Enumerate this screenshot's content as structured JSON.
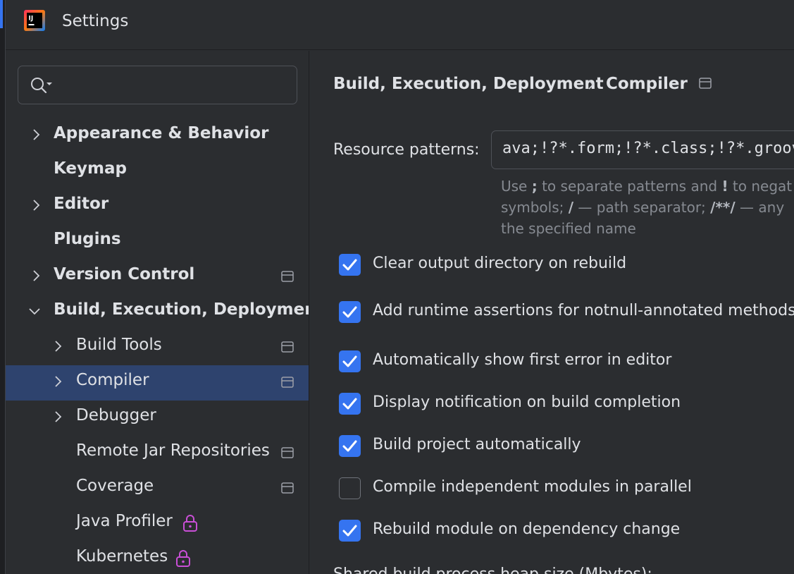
{
  "window": {
    "title": "Settings",
    "app_icon": "intellij-idea-icon"
  },
  "sidebar": {
    "search_placeholder": "",
    "items": [
      {
        "label": "Appearance & Behavior",
        "expandable": true,
        "expanded": false,
        "bold": true
      },
      {
        "label": "Keymap",
        "bold": true
      },
      {
        "label": "Editor",
        "expandable": true,
        "expanded": false,
        "bold": true
      },
      {
        "label": "Plugins",
        "bold": true
      },
      {
        "label": "Version Control",
        "expandable": true,
        "expanded": false,
        "bold": true,
        "icon": "project-settings-icon"
      },
      {
        "label": "Build, Execution, Deployment",
        "expandable": true,
        "expanded": true,
        "bold": true
      },
      {
        "label": "Build Tools",
        "expandable": true,
        "icon": "project-settings-icon"
      },
      {
        "label": "Compiler",
        "expandable": true,
        "selected": true,
        "icon": "project-settings-icon"
      },
      {
        "label": "Debugger",
        "expandable": true
      },
      {
        "label": "Remote Jar Repositories",
        "icon": "project-settings-icon"
      },
      {
        "label": "Coverage",
        "icon": "project-settings-icon"
      },
      {
        "label": "Java Profiler",
        "icon": "lock-icon"
      },
      {
        "label": "Kubernetes",
        "icon": "lock-icon"
      }
    ]
  },
  "main": {
    "breadcrumb": {
      "parent": "Build, Execution, Deployment",
      "separator_icon": "chevron-right-icon",
      "current": "Compiler",
      "icon": "project-settings-icon"
    },
    "resource_patterns": {
      "label": "Resource patterns:",
      "value": "ava;!?*.form;!?*.class;!?*.groovy;!?*.scala;!?*.flex;!?*.kt;!?*.clj;!?*.aj",
      "hint_lines": [
        {
          "pre": "Use ",
          "b1": ";",
          "mid": " to separate patterns and ",
          "b2": "!",
          "post": " to negat"
        },
        {
          "pre": "symbols; ",
          "b1": "/",
          "mid": " — path separator; ",
          "b2": "/**/",
          "post": " — any"
        },
        {
          "pre": "the specified name",
          "b1": "",
          "mid": "",
          "b2": "",
          "post": ""
        }
      ]
    },
    "options": [
      {
        "label": "Clear output directory on rebuild",
        "checked": true
      },
      {
        "label": "Add runtime assertions for notnull-annotated methods",
        "checked": true
      },
      {
        "label": "Automatically show first error in editor",
        "checked": true
      },
      {
        "label": "Display notification on build completion",
        "checked": true
      },
      {
        "label": "Build project automatically",
        "checked": true
      },
      {
        "label": "Compile independent modules in parallel",
        "checked": false
      },
      {
        "label": "Rebuild module on dependency change",
        "checked": true
      }
    ],
    "cut_off_text": "Shared build process heap size (Mbytes):"
  },
  "colors": {
    "accent": "#3574f0",
    "selection": "#2e436e",
    "background": "#2b2d30",
    "text": "#dfe1e5",
    "hint": "#868a91",
    "lock": "#c94fd6"
  }
}
